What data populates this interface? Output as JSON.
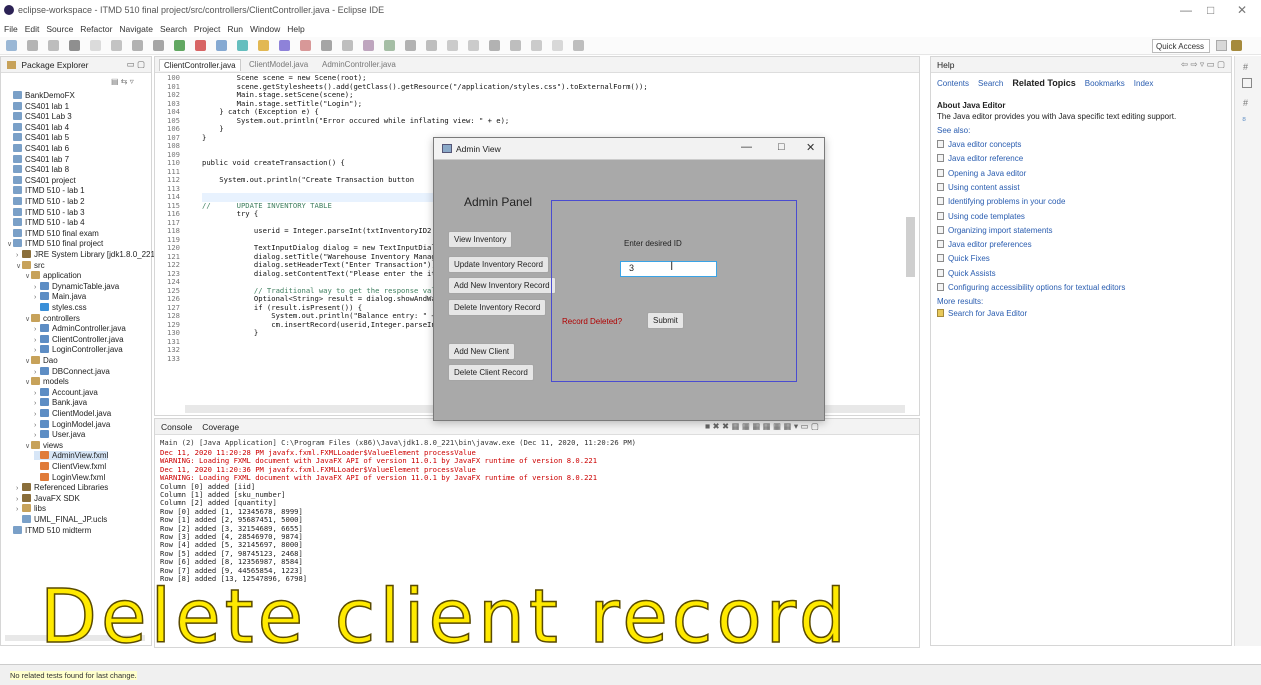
{
  "window": {
    "title": "eclipse-workspace - ITMD 510 final project/src/controllers/ClientController.java - Eclipse IDE"
  },
  "menu": [
    "File",
    "Edit",
    "Source",
    "Refactor",
    "Navigate",
    "Search",
    "Project",
    "Run",
    "Window",
    "Help"
  ],
  "quick_access": "Quick Access",
  "package_explorer": {
    "title": "Package Explorer",
    "items": [
      {
        "label": "BankDemoFX",
        "depth": 0,
        "icon": "project-icon"
      },
      {
        "label": "CS401 lab 1",
        "depth": 0,
        "icon": "project-icon"
      },
      {
        "label": "CS401 Lab 3",
        "depth": 0,
        "icon": "project-icon"
      },
      {
        "label": "CS401 lab 4",
        "depth": 0,
        "icon": "project-icon"
      },
      {
        "label": "CS401 lab 5",
        "depth": 0,
        "icon": "project-icon"
      },
      {
        "label": "CS401 lab 6",
        "depth": 0,
        "icon": "project-icon"
      },
      {
        "label": "CS401 lab 7",
        "depth": 0,
        "icon": "project-icon"
      },
      {
        "label": "CS401 lab 8",
        "depth": 0,
        "icon": "project-icon"
      },
      {
        "label": "CS401 project",
        "depth": 0,
        "icon": "project-icon"
      },
      {
        "label": "ITMD 510 - lab 1",
        "depth": 0,
        "icon": "project-icon"
      },
      {
        "label": "ITMD 510 - lab 2",
        "depth": 0,
        "icon": "project-icon"
      },
      {
        "label": "ITMD 510 - lab 3",
        "depth": 0,
        "icon": "project-icon"
      },
      {
        "label": "ITMD 510 - lab 4",
        "depth": 0,
        "icon": "project-icon"
      },
      {
        "label": "ITMD 510 final exam",
        "depth": 0,
        "icon": "project-icon"
      },
      {
        "label": "ITMD 510 final project",
        "depth": 0,
        "icon": "project-icon"
      },
      {
        "label": "JRE System Library [jdk1.8.0_221]",
        "depth": 1,
        "icon": "library-icon"
      },
      {
        "label": "src",
        "depth": 1,
        "icon": "package-icon"
      },
      {
        "label": "application",
        "depth": 2,
        "icon": "package-icon"
      },
      {
        "label": "DynamicTable.java",
        "depth": 3,
        "icon": "java-file-icon"
      },
      {
        "label": "Main.java",
        "depth": 3,
        "icon": "java-file-icon"
      },
      {
        "label": "styles.css",
        "depth": 3,
        "icon": "css-file-icon"
      },
      {
        "label": "controllers",
        "depth": 2,
        "icon": "package-icon"
      },
      {
        "label": "AdminController.java",
        "depth": 3,
        "icon": "java-file-icon"
      },
      {
        "label": "ClientController.java",
        "depth": 3,
        "icon": "java-file-icon"
      },
      {
        "label": "LoginController.java",
        "depth": 3,
        "icon": "java-file-icon"
      },
      {
        "label": "Dao",
        "depth": 2,
        "icon": "package-icon"
      },
      {
        "label": "DBConnect.java",
        "depth": 3,
        "icon": "java-file-icon"
      },
      {
        "label": "models",
        "depth": 2,
        "icon": "package-icon"
      },
      {
        "label": "Account.java",
        "depth": 3,
        "icon": "java-file-icon"
      },
      {
        "label": "Bank.java",
        "depth": 3,
        "icon": "java-file-icon"
      },
      {
        "label": "ClientModel.java",
        "depth": 3,
        "icon": "java-file-icon"
      },
      {
        "label": "LoginModel.java",
        "depth": 3,
        "icon": "java-file-icon"
      },
      {
        "label": "User.java",
        "depth": 3,
        "icon": "java-file-icon"
      },
      {
        "label": "views",
        "depth": 2,
        "icon": "package-icon"
      },
      {
        "label": "AdminView.fxml",
        "depth": 3,
        "icon": "fxml-file-icon"
      },
      {
        "label": "ClientView.fxml",
        "depth": 3,
        "icon": "fxml-file-icon"
      },
      {
        "label": "LoginView.fxml",
        "depth": 3,
        "icon": "fxml-file-icon"
      },
      {
        "label": "Referenced Libraries",
        "depth": 1,
        "icon": "library-icon"
      },
      {
        "label": "JavaFX SDK",
        "depth": 1,
        "icon": "library-icon"
      },
      {
        "label": "libs",
        "depth": 1,
        "icon": "package-icon"
      },
      {
        "label": "UML_FINAL_JP.ucls",
        "depth": 1,
        "icon": "uml-file-icon"
      },
      {
        "label": "ITMD 510 midterm",
        "depth": 0,
        "icon": "project-icon"
      }
    ]
  },
  "editor": {
    "tabs": [
      "ClientController.java",
      "ClientModel.java",
      "AdminController.java"
    ],
    "line_numbers": [
      "100",
      "101",
      "102",
      "103",
      "104",
      "105",
      "106",
      "107",
      "108",
      "109",
      "110",
      "111",
      "112",
      "113",
      "114",
      "115",
      "116",
      "117",
      "118",
      "119",
      "120",
      "121",
      "122",
      "123",
      "124",
      "125",
      "126",
      "127",
      "128",
      "129",
      "130",
      "131",
      "132",
      "133"
    ],
    "lines": [
      "        Scene scene = new Scene(root);",
      "        scene.getStylesheets().add(getClass().getResource(\"/application/styles.css\").toExternalForm());",
      "        Main.stage.setScene(scene);",
      "        Main.stage.setTitle(\"Login\");",
      "    } catch (Exception e) {",
      "        System.out.println(\"Error occured while inflating view: \" + e);",
      "    }",
      "}",
      "",
      "",
      "public void createTransaction() {",
      "",
      "    System.out.println(\"Create Transaction button",
      "",
      "",
      "//      UPDATE INVENTORY TABLE",
      "        try {",
      "",
      "            userid = Integer.parseInt(txtInventoryID2.",
      "",
      "            TextInputDialog dialog = new TextInputDial",
      "            dialog.setTitle(\"Warehouse Inventory Manag",
      "            dialog.setHeaderText(\"Enter Transaction\");",
      "            dialog.setContentText(\"Please enter the it",
      "",
      "            // Traditional way to get the response val",
      "            Optional<String> result = dialog.showAndWa",
      "            if (result.isPresent()) {",
      "                System.out.println(\"Balance entry: \" +",
      "                cm.insertRecord(userid,Integer.parseIn",
      "            }",
      "",
      "",
      ""
    ]
  },
  "console": {
    "tabs": [
      "Console",
      "Coverage"
    ],
    "header": "Main (2) [Java Application] C:\\Program Files (x86)\\Java\\jdk1.8.0_221\\bin\\javaw.exe (Dec 11, 2020, 11:20:26 PM)",
    "lines": [
      {
        "text": "Dec 11, 2020 11:20:28 PM javafx.fxml.FXMLLoader$ValueElement processValue",
        "error": true
      },
      {
        "text": "WARNING: Loading FXML document with JavaFX API of version 11.0.1 by JavaFX runtime of version 8.0.221",
        "error": true
      },
      {
        "text": "Dec 11, 2020 11:20:36 PM javafx.fxml.FXMLLoader$ValueElement processValue",
        "error": true
      },
      {
        "text": "WARNING: Loading FXML document with JavaFX API of version 11.0.1 by JavaFX runtime of version 8.0.221",
        "error": true
      },
      {
        "text": "Column [0] added [iid]",
        "error": false
      },
      {
        "text": "Column [1] added [sku_number]",
        "error": false
      },
      {
        "text": "Column [2] added [quantity]",
        "error": false
      },
      {
        "text": "Row [0] added [1, 12345678, 8999]",
        "error": false
      },
      {
        "text": "Row [1] added [2, 95687451, 5000]",
        "error": false
      },
      {
        "text": "Row [2] added [3, 32154689, 6655]",
        "error": false
      },
      {
        "text": "Row [3] added [4, 28546970, 9874]",
        "error": false
      },
      {
        "text": "Row [4] added [5, 32145697, 8000]",
        "error": false
      },
      {
        "text": "Row [5] added [7, 98745123, 2468]",
        "error": false
      },
      {
        "text": "Row [6] added [8, 12356987, 8584]",
        "error": false
      },
      {
        "text": "Row [7] added [9, 44565854, 1223]",
        "error": false
      },
      {
        "text": "Row [8] added [13, 12547896, 6798]",
        "error": false
      }
    ]
  },
  "help": {
    "title": "Help",
    "tabs": [
      "Contents",
      "Search",
      "Related Topics",
      "Bookmarks",
      "Index"
    ],
    "heading": "About Java Editor",
    "description": "The Java editor provides you with Java specific text editing support.",
    "see_also": "See also:",
    "links": [
      "Java editor concepts",
      "Java editor reference",
      "Opening a Java editor",
      "Using content assist",
      "Identifying problems in your code",
      "Using code templates",
      "Organizing import statements",
      "Java editor preferences",
      "Quick Fixes",
      "Quick Assists",
      "Configuring accessibility options for textual editors"
    ],
    "more_results": "More results:",
    "search_link": "Search for Java Editor"
  },
  "admin_window": {
    "title": "Admin View",
    "panel_title": "Admin Panel",
    "buttons": [
      "View Inventory",
      "Update Inventory Record",
      "Add New Inventory Record",
      "Delete Inventory Record",
      "Add New Client",
      "Delete Client Record"
    ],
    "id_label": "Enter desired ID",
    "id_value": "3",
    "status_label": "Record Deleted?",
    "submit": "Submit"
  },
  "status_bar": {
    "text": "No related tests found for last change."
  },
  "overlay_caption": "Delete client record",
  "colors": {
    "overlay_text": "#ffea00",
    "admin_bg": "#a9a9a9",
    "pane_border": "#4a4cd0",
    "input_focus": "#39a3e6"
  }
}
